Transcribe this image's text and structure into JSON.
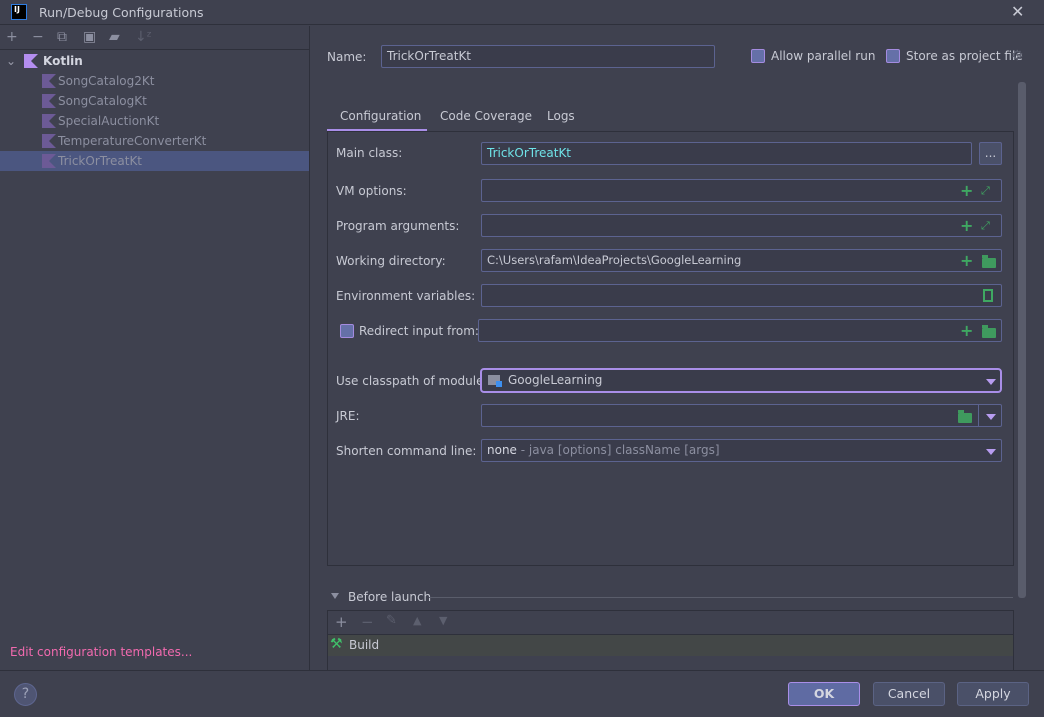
{
  "window": {
    "title": "Run/Debug Configurations",
    "logo": "IJ",
    "close": "✕"
  },
  "toolbar": {
    "icons": [
      "add-icon",
      "remove-icon",
      "copy-icon",
      "save-icon",
      "new-folder-icon",
      "sort-icon"
    ],
    "glyphs": [
      "+",
      "−",
      "⧉",
      "▣",
      "▰",
      "↓ᶻ"
    ]
  },
  "tree": {
    "group": "Kotlin",
    "items": [
      "SongCatalog2Kt",
      "SongCatalogKt",
      "SpecialAuctionKt",
      "TemperatureConverterKt",
      "TrickOrTreatKt"
    ],
    "selected": "TrickOrTreatKt"
  },
  "left_link": "Edit configuration templates...",
  "name": {
    "label": "Name:",
    "value": "TrickOrTreatKt"
  },
  "options": {
    "allow_parallel": "Allow parallel run",
    "store_project": "Store as project file"
  },
  "tabs": [
    "Configuration",
    "Code Coverage",
    "Logs"
  ],
  "active_tab": "Configuration",
  "form": {
    "main_class": {
      "label": "Main class:",
      "value": "TrickOrTreatKt",
      "browse": "..."
    },
    "vm_options": {
      "label": "VM options:",
      "value": ""
    },
    "program_args": {
      "label": "Program arguments:",
      "value": ""
    },
    "working_dir": {
      "label": "Working directory:",
      "value": "C:\\Users\\rafam\\IdeaProjects\\GoogleLearning"
    },
    "env_vars": {
      "label": "Environment variables:",
      "value": ""
    },
    "redirect": {
      "label": "Redirect input from:",
      "value": ""
    },
    "classpath": {
      "label": "Use classpath of module:",
      "value": "GoogleLearning"
    },
    "jre": {
      "label": "JRE:",
      "value": ""
    },
    "shorten": {
      "label": "Shorten command line:",
      "value": "none",
      "hint": " - java [options] className [args]"
    }
  },
  "before_launch": {
    "title": "Before launch",
    "items": [
      "Build"
    ]
  },
  "buttons": {
    "ok": "OK",
    "cancel": "Cancel",
    "apply": "Apply",
    "help": "?"
  },
  "colors": {
    "accent": "#a98ee8",
    "selection": "#4b5680",
    "link": "#f26aaf",
    "main_class_text": "#6fe3e8"
  }
}
